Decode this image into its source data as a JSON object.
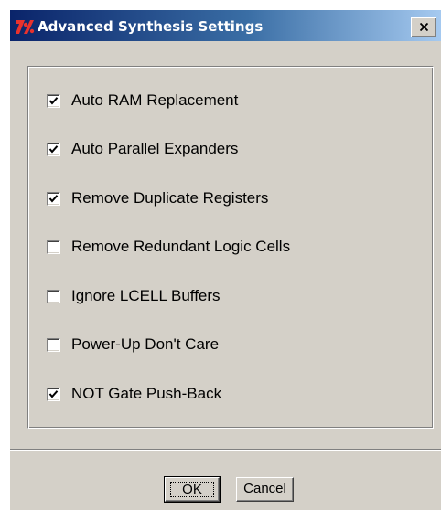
{
  "window": {
    "title": "Advanced Synthesis Settings",
    "close_label": "X"
  },
  "options": [
    {
      "label": "Auto RAM Replacement",
      "checked": true
    },
    {
      "label": "Auto Parallel Expanders",
      "checked": true
    },
    {
      "label": "Remove Duplicate Registers",
      "checked": true
    },
    {
      "label": "Remove Redundant Logic Cells",
      "checked": false
    },
    {
      "label": "Ignore LCELL Buffers",
      "checked": false
    },
    {
      "label": "Power-Up Don't Care",
      "checked": false
    },
    {
      "label": "NOT Gate Push-Back",
      "checked": true
    }
  ],
  "buttons": {
    "ok_label": "OK",
    "cancel_first": "C",
    "cancel_rest": "ancel"
  },
  "colors": {
    "title_start": "#0a246a",
    "title_end": "#a6caf0",
    "dialog_face": "#d4d0c8"
  }
}
